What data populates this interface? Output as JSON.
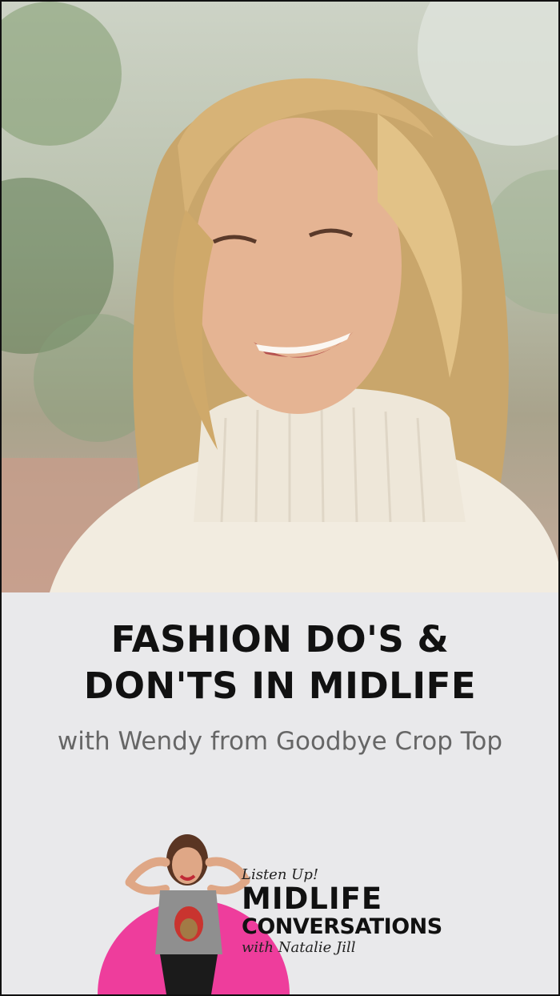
{
  "headline": {
    "line1": "FASHION DO'S &",
    "line2": "DON'TS IN MIDLIFE"
  },
  "subtitle": "with Wendy from Goodbye Crop Top",
  "podcast": {
    "tagline": "Listen Up!",
    "title_line1": "MIDLIFE",
    "title_line2": "CONVERSATIONS",
    "host": "with Natalie Jill"
  },
  "colors": {
    "background": "#e9e9eb",
    "accent_pink": "#ee3d9c",
    "text_dark": "#111111",
    "text_muted": "#666666"
  }
}
